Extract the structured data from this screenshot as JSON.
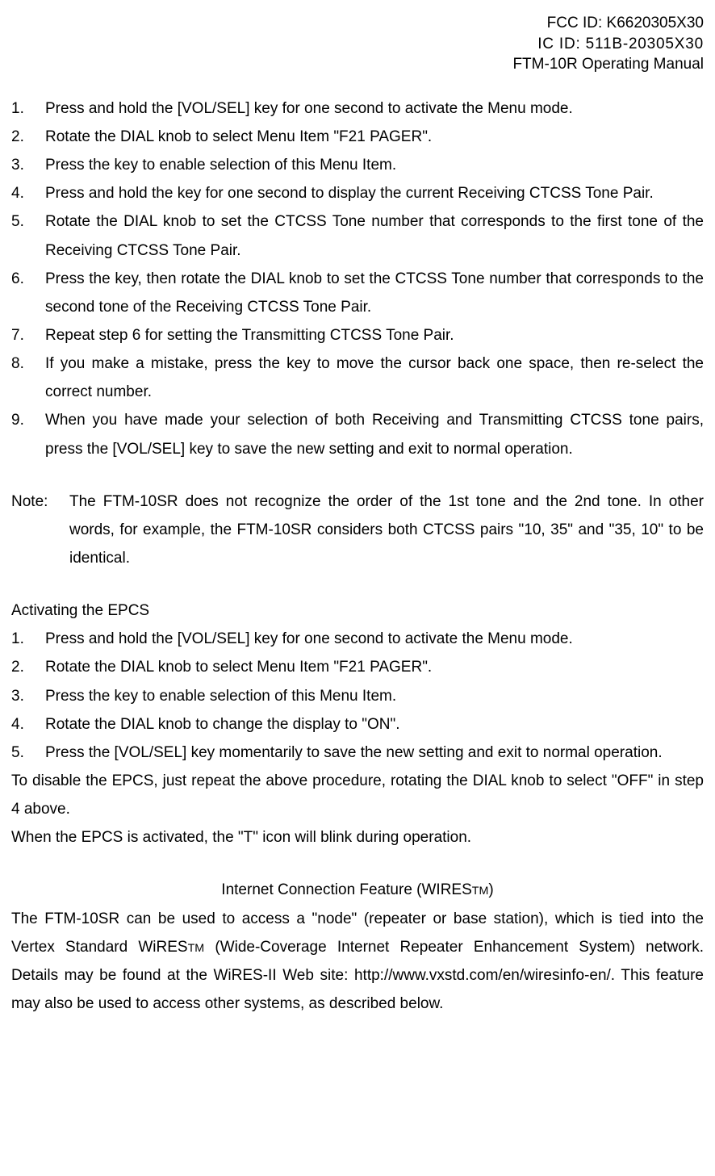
{
  "header": {
    "line1": "FCC ID: K6620305X30",
    "line2": "IC ID: 511B-20305X30",
    "line3": "FTM-10R Operating Manual"
  },
  "listA": {
    "items": [
      {
        "num": "1.",
        "text": "Press and hold the [VOL/SEL] key for one second to activate the Menu mode."
      },
      {
        "num": "2.",
        "text": "Rotate the DIAL knob to select Menu Item \"F21 PAGER\"."
      },
      {
        "num": "3.",
        "text": "Press the    key to enable selection of this Menu Item."
      },
      {
        "num": "4.",
        "text": "Press and hold the    key for one second to display the current Receiving CTCSS Tone Pair."
      },
      {
        "num": "5.",
        "text": "Rotate the DIAL knob to set the CTCSS Tone number that corresponds to the first tone of the Receiving CTCSS Tone Pair."
      },
      {
        "num": "6.",
        "text": "Press the   key, then rotate the DIAL knob to set the CTCSS Tone number that corresponds to the second tone of the Receiving CTCSS Tone Pair."
      },
      {
        "num": "7.",
        "text": "Repeat step 6 for setting the Transmitting CTCSS Tone Pair."
      },
      {
        "num": "8.",
        "text": "If you make a mistake, press the   key to move the cursor back one space, then re-select the correct number."
      },
      {
        "num": "9.",
        "text": "When you have made your selection of both Receiving and Transmitting CTCSS tone pairs, press the [VOL/SEL] key to save the new setting and exit to normal operation."
      }
    ]
  },
  "note": {
    "label": "Note:",
    "text": "The FTM-10SR does not recognize the order of the 1st tone and the 2nd tone. In other words, for example, the FTM-10SR considers both CTCSS pairs \"10, 35\" and \"35, 10\" to be identical."
  },
  "sectionB_heading": "Activating the EPCS",
  "listB": {
    "items": [
      {
        "num": "1.",
        "text": "Press and hold the [VOL/SEL] key for one second to activate the Menu mode."
      },
      {
        "num": "2.",
        "text": "Rotate the DIAL knob to select Menu Item \"F21 PAGER\"."
      },
      {
        "num": "3.",
        "text": "Press the    key to enable selection of this Menu Item."
      },
      {
        "num": "4.",
        "text": "Rotate the DIAL knob to change the display to \"ON\"."
      },
      {
        "num": "5.",
        "text": "Press the [VOL/SEL] key momentarily to save the new setting and exit to normal operation."
      }
    ]
  },
  "paraB1": "To disable the EPCS, just repeat the above procedure, rotating the DIAL knob to select \"OFF\" in step 4 above.",
  "paraB2": "When the EPCS is activated, the \"T\" icon will blink during operation.",
  "sectionC_heading_pre": "Internet Connection Feature (WIRES",
  "sectionC_heading_sub": "TM",
  "sectionC_heading_post": ")",
  "paraC_pre": "The FTM-10SR can be used to access a \"node\" (repeater or base station), which is tied into the Vertex Standard WiRES",
  "paraC_sub": "TM",
  "paraC_post": " (Wide-Coverage Internet Repeater Enhancement System) network. Details may be found at the WiRES-II Web site: http://www.vxstd.com/en/wiresinfo-en/. This feature may also be used to access other systems, as described below."
}
